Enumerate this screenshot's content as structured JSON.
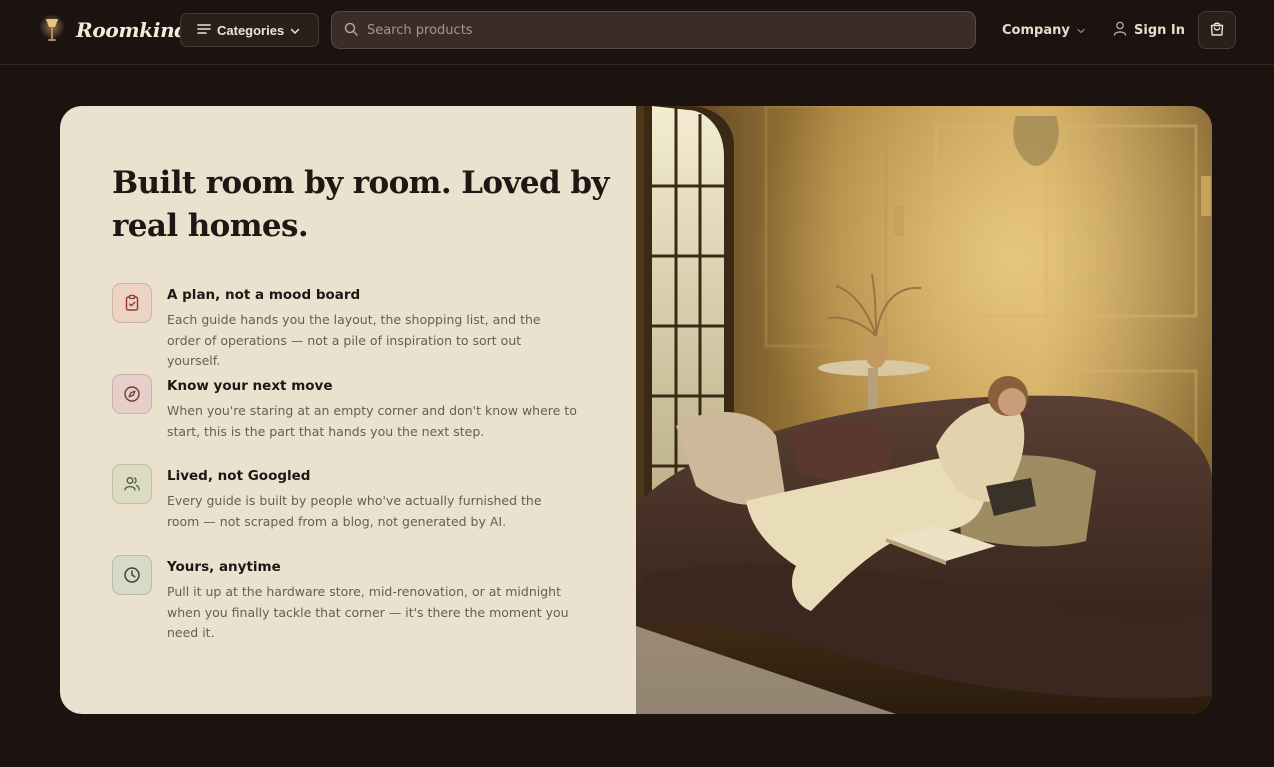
{
  "header": {
    "brand": "Roomkindle",
    "categories_label": "Categories",
    "search_placeholder": "Search products",
    "company_label": "Company",
    "signin_label": "Sign In"
  },
  "hero": {
    "headline": "Built room by room. Loved by real homes.",
    "features": [
      {
        "icon": "clipboard-check-icon",
        "title": "A plan, not a mood board",
        "description": "Each guide hands you the layout, the shopping list, and the order of operations — not a pile of inspiration to sort out yourself.",
        "color": "#ecd3c3"
      },
      {
        "icon": "compass-icon",
        "title": "Know your next move",
        "description": "When you're staring at an empty corner and don't know where to start, this is the part that hands you the next step.",
        "color": "#e6cfc9"
      },
      {
        "icon": "users-icon",
        "title": "Lived, not Googled",
        "description": "Every guide is built by people who've actually furnished the room — not scraped from a blog, not generated by AI.",
        "color": "#dcdcc3"
      },
      {
        "icon": "clock-icon",
        "title": "Yours, anytime",
        "description": "Pull it up at the hardware store, mid-renovation, or at midnight when you finally tackle that corner — it's there the moment you need it.",
        "color": "#d7dac6"
      }
    ]
  },
  "colors": {
    "page_bg": "#1c1310",
    "card_bg": "#ebe1cf",
    "heading": "#1f1713",
    "body_text": "#6a5d53"
  }
}
